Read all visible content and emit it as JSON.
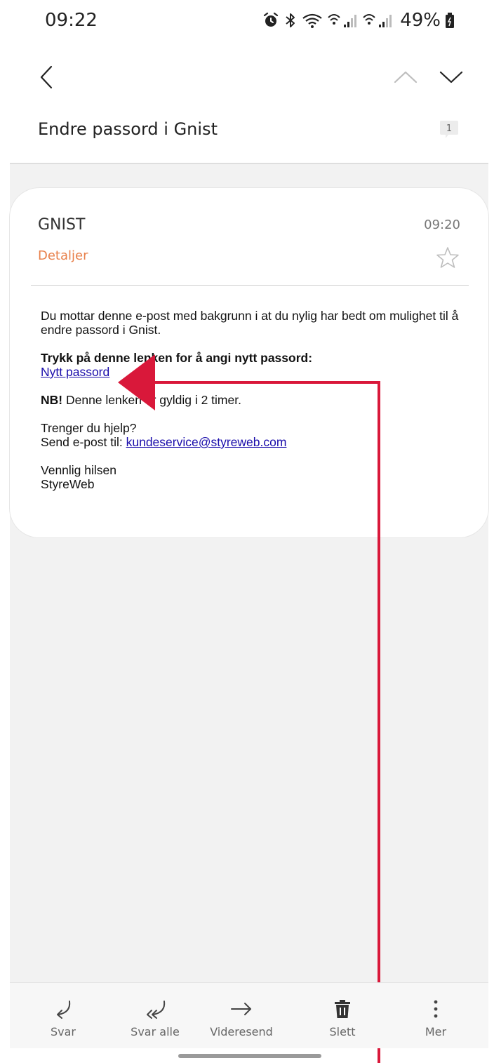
{
  "status_bar": {
    "time": "09:22",
    "battery_percent": "49%",
    "icons": [
      "alarm-icon",
      "bluetooth-icon",
      "wifi-icon",
      "sim1-signal-icon",
      "sim2-signal-icon",
      "battery-icon"
    ]
  },
  "nav": {
    "back_icon": "chevron-left-icon",
    "prev_icon": "chevron-up-icon",
    "next_icon": "chevron-down-icon"
  },
  "message": {
    "subject": "Endre passord i Gnist",
    "thread_count": "1",
    "sender": "GNIST",
    "received_time": "09:20",
    "details_label": "Detaljer",
    "body": {
      "intro": "Du mottar denne e-post med bakgrunn i at du nylig har bedt om mulighet til å endre passord i Gnist.",
      "instruction": "Trykk på denne lenken for å angi nytt passord:",
      "link_text": "Nytt passord",
      "nb_label": "NB!",
      "nb_text": " Denne lenken er gyldig i 2 timer.",
      "help_question": "Trenger du hjelp?",
      "help_prefix": "Send e-post til: ",
      "help_email": "kundeservice@styreweb.com",
      "closing": "Vennlig hilsen",
      "signature": "StyreWeb"
    }
  },
  "actions": [
    {
      "label": "Svar",
      "icon": "reply-icon"
    },
    {
      "label": "Svar alle",
      "icon": "reply-all-icon"
    },
    {
      "label": "Videresend",
      "icon": "forward-icon"
    },
    {
      "label": "Slett",
      "icon": "trash-icon"
    },
    {
      "label": "Mer",
      "icon": "more-vertical-icon"
    }
  ],
  "colors": {
    "accent": "#e8804a",
    "link": "#1a0dab",
    "annotation": "#d9183a"
  }
}
